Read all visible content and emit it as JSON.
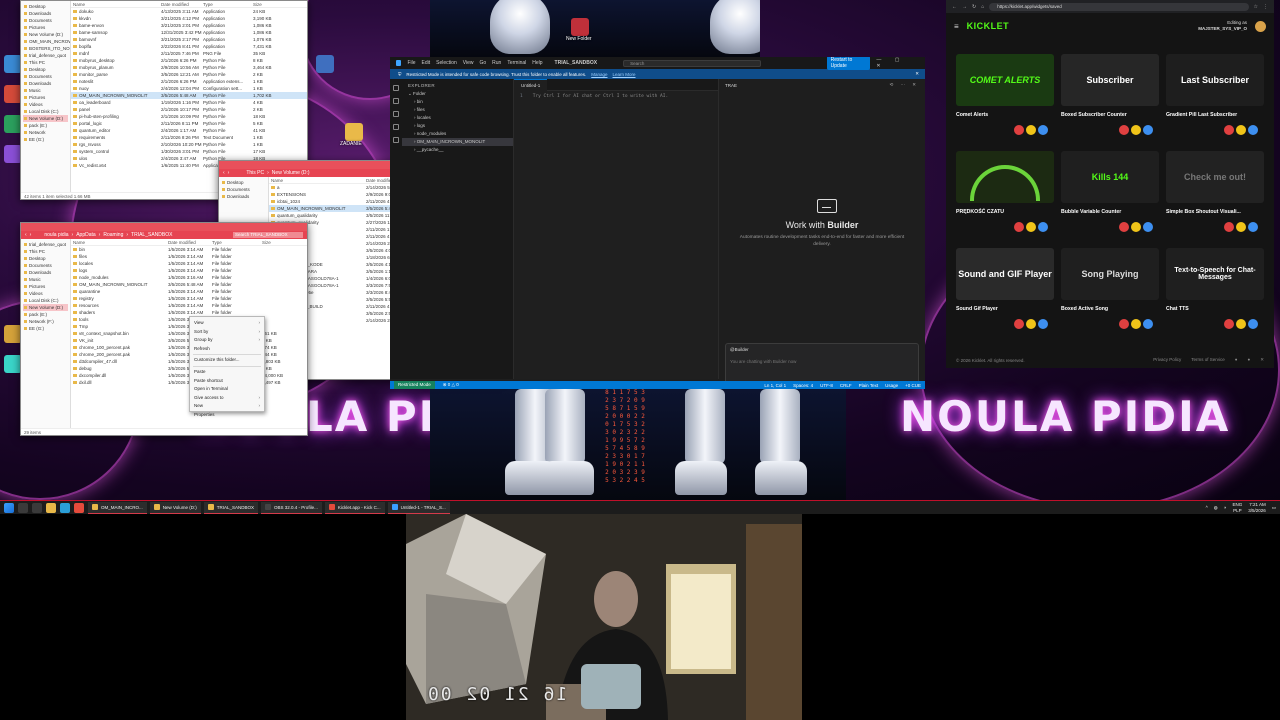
{
  "desktop": {
    "wallpaper_text": "NOULA PIDIA",
    "icons": [
      {
        "label": "NOULA PIDIA"
      },
      {
        "label": "New Folder"
      },
      {
        "label": "ZADANIE"
      }
    ]
  },
  "explorer_top": {
    "columns": [
      "Name",
      "Date modified",
      "Type",
      "Size"
    ],
    "nav": [
      "Desktop",
      "Downloads",
      "Documents",
      "Pictures",
      "New Volume (D:)",
      "OMI_MAIN_INCROWN",
      "BOSTERS_ITO_NOULA",
      "trial_defense_quot",
      "This PC",
      "Desktop",
      "Documents",
      "Downloads",
      "Music",
      "Pictures",
      "Videos",
      "Local Disk (C:)",
      "New Volume (D:)",
      "pack (E:)",
      "Network",
      "EE (G:)"
    ],
    "rows": [
      {
        "name": "dokuko",
        "date": "4/13/2025 3:11 AM",
        "type": "Application",
        "size": "24 KB"
      },
      {
        "name": "kkvdn",
        "date": "3/21/2025 4:12 PM",
        "type": "Application",
        "size": "3,190 KB"
      },
      {
        "name": "bame-envon",
        "date": "3/21/2025 2:01 PM",
        "type": "Application",
        "size": "1,086 KB"
      },
      {
        "name": "bame-samsop",
        "date": "12/31/2025 3:42 PM",
        "type": "Application",
        "size": "1,086 KB"
      },
      {
        "name": "bamovnf",
        "date": "3/21/2025 2:17 PM",
        "type": "Application",
        "size": "1,076 KB"
      },
      {
        "name": "boplfa",
        "date": "2/22/2026 8:41 PM",
        "type": "Application",
        "size": "7,431 KB"
      },
      {
        "name": "mdnf",
        "date": "2/11/2025 7:46 PM",
        "type": "PNG File",
        "size": "35 KB"
      },
      {
        "name": "mobyrus_desktop",
        "date": "2/1/2026 6:26 PM",
        "type": "Python File",
        "size": "8 KB"
      },
      {
        "name": "mobyrus_planum",
        "date": "2/9/2026 10:56 AM",
        "type": "Python File",
        "size": "3,464 KB"
      },
      {
        "name": "monitor_parse",
        "date": "3/5/2026 12:21 AM",
        "type": "Python File",
        "size": "2 KB"
      },
      {
        "name": "noteslit",
        "date": "2/1/2026 6:26 PM",
        "type": "Application extens...",
        "size": "1 KB"
      },
      {
        "name": "nuoy",
        "date": "2/4/2026 12:04 PM",
        "type": "Configuration sett...",
        "size": "1 KB"
      },
      {
        "name": "OM_MAIN_INCROWN_MONOLIT",
        "date": "3/5/2026 5:48 AM",
        "type": "Python File",
        "size": "1,702 KB"
      },
      {
        "name": "oa_leaderboard",
        "date": "1/19/2026 1:16 PM",
        "type": "Python File",
        "size": "4 KB"
      },
      {
        "name": "panel",
        "date": "2/1/2026 10:17 PM",
        "type": "Python File",
        "size": "2 KB"
      },
      {
        "name": "pi-hub-sten-profiling",
        "date": "2/1/2026 10:09 PM",
        "type": "Python File",
        "size": "18 KB"
      },
      {
        "name": "portal_logic",
        "date": "2/11/2026 8:11 PM",
        "type": "Python File",
        "size": "5 KB"
      },
      {
        "name": "quantum_editor",
        "date": "2/4/2026 1:17 AM",
        "type": "Python File",
        "size": "41 KB"
      },
      {
        "name": "requirements",
        "date": "2/11/2026 8:26 PM",
        "type": "Text Document",
        "size": "1 KB"
      },
      {
        "name": "rgs_rsvoss",
        "date": "2/10/2026 10:20 PM",
        "type": "Python File",
        "size": "1 KB"
      },
      {
        "name": "system_control",
        "date": "1/30/2026 3:01 PM",
        "type": "Python File",
        "size": "17 KB"
      },
      {
        "name": "ulos",
        "date": "2/4/2026 3:47 AM",
        "type": "Python File",
        "size": "18 KB"
      },
      {
        "name": "Vc_redist.x64",
        "date": "1/6/2025 11:40 PM",
        "type": "Application",
        "size": "24,703 KB"
      }
    ],
    "status": "42 items   1 item selected   1.66 MB"
  },
  "explorer_mid": {
    "breadcrumb": [
      "This PC",
      "New Volume (D:)"
    ],
    "search_placeholder": "Search New Volume (D:)",
    "columns": [
      "Name",
      "Date modified",
      "Type",
      "Size"
    ],
    "nav": [
      "Desktop",
      "Documents",
      "Downloads"
    ],
    "rows": [
      {
        "name": "a",
        "date": "2/14/2026 5:27 AM",
        "type": "File folder",
        "size": ""
      },
      {
        "name": "EXTENSIONS",
        "date": "2/9/2026 9:02 PM",
        "type": "File folder",
        "size": ""
      },
      {
        "name": "icbtai_1024",
        "date": "2/11/2026 4:39 PM",
        "type": "File folder",
        "size": ""
      },
      {
        "name": "OM_MAIN_INCROWN_MONOLIT",
        "date": "3/5/2026 5:46 AM",
        "type": "File folder",
        "size": ""
      },
      {
        "name": "quantum_qualidarity",
        "date": "3/5/2026 11:28 AM",
        "type": "File folder",
        "size": ""
      },
      {
        "name": "quamtum_qualidarity",
        "date": "2/27/2026 11:48 AM",
        "type": "File folder",
        "size": ""
      },
      {
        "name": "python",
        "date": "2/11/2026 1:23 AM",
        "type": "File folder",
        "size": ""
      },
      {
        "name": "tools",
        "date": "2/11/2026 4:00 AM",
        "type": "File folder",
        "size": ""
      },
      {
        "name": "zz_NEWS",
        "date": "2/14/2026 2:08 PM",
        "type": "File folder",
        "size": ""
      },
      {
        "name": "quxe",
        "date": "3/5/2026 4:00 AM",
        "type": "Python File",
        "size": "176 KB"
      },
      {
        "name": "dms",
        "date": "1/18/2026 6:11 AM",
        "type": "Text Document",
        "size": "0 KB"
      },
      {
        "name": "WSZYSTKO_Z_KODE",
        "date": "3/5/2026 4:10 AM",
        "type": "Text Document",
        "size": "5 KB"
      },
      {
        "name": "PACZKA_WAGARA",
        "date": "3/5/2026 1:14 AM",
        "type": "Text Document",
        "size": "1,182 KB"
      },
      {
        "name": "SCA_PACZKA-ASGOLD78A-1",
        "date": "1/4/2026 6:04 AM",
        "type": "Zip Archive",
        "size": "1,580 KB"
      },
      {
        "name": "SCA_PACZKA-ASGOLD78A-1",
        "date": "3/3/2026 7:51 AM",
        "type": "Zip Archive",
        "size": "1,580 KB"
      },
      {
        "name": "textyp_spec54e5e",
        "date": "3/3/2026 8:49 AM",
        "type": "Zip Archive",
        "size": "2,007 KB"
      },
      {
        "name": "python_fixed",
        "date": "3/5/2026 5:58 AM",
        "type": "zip Archive",
        "size": "535 KB"
      },
      {
        "name": "V2_CURRENT_BUILD",
        "date": "2/11/2026 4:06 AM",
        "type": "zip Archive",
        "size": "1,162 KB"
      },
      {
        "name": "V2_CURRENT",
        "date": "3/5/2026 2:51 AM",
        "type": "zip Archive",
        "size": "335 KB"
      },
      {
        "name": "x_ESCALI",
        "date": "2/14/2026 2:48 AM",
        "type": "Application",
        "size": "1,086 KB"
      }
    ]
  },
  "explorer_bottom": {
    "breadcrumb": [
      "noula pidia",
      "AppData",
      "Roaming",
      "TRIAL_SANDBOX"
    ],
    "search_placeholder": "Search TRIAL_SANDBOX",
    "columns": [
      "Name",
      "Date modified",
      "Type",
      "Size"
    ],
    "nav": [
      "trial_defense_quot",
      "This PC",
      "Desktop",
      "Documents",
      "Downloads",
      "Music",
      "Pictures",
      "Videos",
      "Local Disk (C:)",
      "New Volume (D:)",
      "pack (E:)",
      "Network (F:)",
      "EE (G:)"
    ],
    "rows": [
      {
        "name": "bin",
        "date": "1/5/2026 3:14 AM",
        "type": "File folder",
        "size": ""
      },
      {
        "name": "files",
        "date": "1/5/2026 3:14 AM",
        "type": "File folder",
        "size": ""
      },
      {
        "name": "locales",
        "date": "1/5/2026 3:14 AM",
        "type": "File folder",
        "size": ""
      },
      {
        "name": "logs",
        "date": "1/5/2026 3:14 AM",
        "type": "File folder",
        "size": ""
      },
      {
        "name": "node_modules",
        "date": "1/5/2026 3:16 AM",
        "type": "File folder",
        "size": ""
      },
      {
        "name": "OM_MAIN_INCROWN_MONOLIT",
        "date": "3/5/2026 5:48 AM",
        "type": "File folder",
        "size": ""
      },
      {
        "name": "quarantine",
        "date": "1/5/2026 3:14 AM",
        "type": "File folder",
        "size": ""
      },
      {
        "name": "registry",
        "date": "1/5/2026 3:14 AM",
        "type": "File folder",
        "size": ""
      },
      {
        "name": "resources",
        "date": "1/5/2026 3:14 AM",
        "type": "File folder",
        "size": ""
      },
      {
        "name": "shaders",
        "date": "1/5/2026 3:14 AM",
        "type": "File folder",
        "size": ""
      },
      {
        "name": "tools",
        "date": "1/5/2026 3:14 AM",
        "type": "File folder",
        "size": ""
      },
      {
        "name": "Tmp",
        "date": "1/5/2026 3:14 AM",
        "type": "File folder",
        "size": ""
      },
      {
        "name": "v8_context_snapshot.bin",
        "date": "1/5/2026 3:14 AM",
        "type": "BIN File",
        "size": "661 KB"
      },
      {
        "name": "VK_init",
        "date": "3/5/2026 5:48 AM",
        "type": "File",
        "size": "1 KB"
      },
      {
        "name": "chrome_100_percent.pak",
        "date": "1/5/2026 3:14 AM",
        "type": "PAK File",
        "size": "174 KB"
      },
      {
        "name": "chrome_200_percent.pak",
        "date": "1/5/2026 3:14 AM",
        "type": "PAK File",
        "size": "244 KB"
      },
      {
        "name": "d3dcompiler_47.dll",
        "date": "1/5/2026 3:14 AM",
        "type": "Application ext",
        "size": "4,803 KB"
      },
      {
        "name": "debug",
        "date": "3/5/2026 5:48 AM",
        "type": "Text Document",
        "size": "1 KB"
      },
      {
        "name": "dxcompiler.dll",
        "date": "1/5/2026 3:14 AM",
        "type": "Application ext",
        "size": "24,000 KB"
      },
      {
        "name": "dxil.dll",
        "date": "1/5/2026 3:14 AM",
        "type": "Application ext",
        "size": "1,497 KB"
      }
    ],
    "status": "29 items"
  },
  "context_menu": {
    "items": [
      "View",
      "Sort by",
      "Group by",
      "Refresh",
      "Customize this folder...",
      "Paste",
      "Paste shortcut",
      "Open in Terminal",
      "Give access to",
      "New",
      "Properties"
    ]
  },
  "vscode": {
    "menu": [
      "File",
      "Edit",
      "Selection",
      "View",
      "Go",
      "Run",
      "Terminal",
      "Help"
    ],
    "window_title": "TRIAL_SANDBOX",
    "command_center": "Search",
    "update_button": "Restart to Update",
    "banner": "Restricted Mode is intended for safe code browsing. Trust this folder to enable all features.",
    "banner_manage": "Manage",
    "banner_learn": "Learn More",
    "explorer_title": "EXPLORER",
    "explorer_items": [
      "Folder",
      "bin",
      "files",
      "locales",
      "logs",
      "node_modules",
      "OM_MAIN_INCROWN_MONOLIT",
      "__pycache__"
    ],
    "tab": "Untitled-1",
    "code_hint": "Try  Ctrl I  for AI chat or  Ctrl I  to write with AI.",
    "chat_tab": "TRAE",
    "builder_title_prefix": "Work with",
    "builder_title": "Builder",
    "builder_sub": "Automates routine development tasks end-to-end for faster and more efficient delivery.",
    "chat_agent": "@Builder",
    "chat_placeholder": "You are chatting with Builder now",
    "model": "GPT-5 medium",
    "status_restricted": "Restricted Mode",
    "status_errors": "⊗ 0 △ 0",
    "status_right": [
      "Ln 1, Col 1",
      "Spaces: 4",
      "UTF-8",
      "CRLF",
      "Plain Text",
      "Usage",
      "+0 CUE"
    ]
  },
  "browser": {
    "url": "https://kicklet.app/widgets/saved",
    "logo": "KICKLET",
    "user_line1": "Editing as",
    "user_line2": "MAJSTER_SYS_VIP_O",
    "widgets": [
      {
        "name": "Comet Alerts",
        "thumb": "COMET ALERTS",
        "bg": "#1a3a12",
        "fg": "#53fc18"
      },
      {
        "name": "Boxed Subscriber Counter",
        "thumb": "Subscriber",
        "bg": "#262626",
        "fg": "#ffffff"
      },
      {
        "name": "Gradient Pill Last Subscriber",
        "thumb": "Last Subscriber",
        "bg": "#1e1e1e",
        "fg": "#ffffff"
      },
      {
        "name": "PRĘDKOŚĆ CZATU",
        "thumb": "",
        "bg": "#1c2a12",
        "fg": "#9aff6a"
      },
      {
        "name": "Bubble Variable Counter",
        "thumb": "Kills 144",
        "bg": "#1f1f1f",
        "fg": "#53fc18"
      },
      {
        "name": "Simple Box Shoutout Visuali...",
        "thumb": "Check me out!",
        "bg": "#222222",
        "fg": "#777777"
      },
      {
        "name": "Sound Gif Player",
        "thumb": "Sound and GIF Player",
        "bg": "#2a2a2a",
        "fg": "#ffffff"
      },
      {
        "name": "Boxed Active Song",
        "thumb": "Song Playing",
        "bg": "#1f1f1f",
        "fg": "#dddddd"
      },
      {
        "name": "Chat TTS",
        "thumb": "Text-to-Speech for Chat-Messages",
        "bg": "#1f1f1f",
        "fg": "#ffffff"
      }
    ],
    "footer": "© 2026 Kicklet. All rights reserved.",
    "footer_links": [
      "Privacy Policy",
      "Terms of Service"
    ]
  },
  "taskbar": {
    "apps": [
      {
        "label": "OM_MAIN_INCRO..."
      },
      {
        "label": "New Volume (D:)"
      },
      {
        "label": "TRIAL_SANDBOX"
      },
      {
        "label": "OBS 32.0.4 - Profile..."
      },
      {
        "label": "Kicklet.app - Kick C..."
      },
      {
        "label": "Untitled-1 - TRIAL_S..."
      }
    ],
    "lang1": "ENG",
    "lang2": "PLP",
    "time": "7:21 AM",
    "date": "3/5/2026"
  },
  "webcam": {
    "timestamp": "16 21 02 00"
  }
}
